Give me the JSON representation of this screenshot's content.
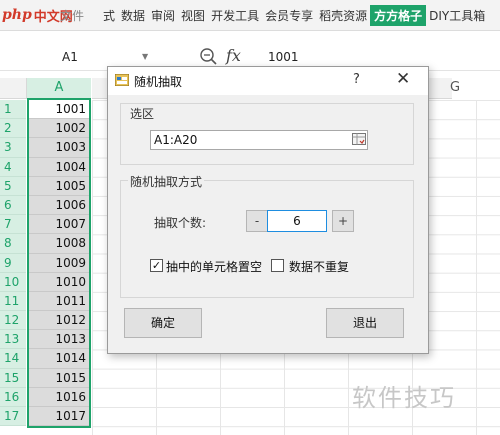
{
  "brand": {
    "logo_php": "php",
    "logo_cn": "中文网"
  },
  "ribbon": {
    "file_label": "文件",
    "tabs": [
      "式",
      "数据",
      "审阅",
      "视图",
      "开发工具",
      "会员专享",
      "稻壳资源",
      "方方格子",
      "DIY工具箱"
    ],
    "active_tab": "方方格子",
    "accent": "#1ea36a"
  },
  "formula_bar": {
    "name_box": "A1",
    "fx_label": "fx",
    "value": "1001"
  },
  "sheet": {
    "col_a": "A",
    "col_g": "G",
    "row_numbers": [
      "1",
      "2",
      "3",
      "4",
      "5",
      "6",
      "7",
      "8",
      "9",
      "10",
      "11",
      "12",
      "13",
      "14",
      "15",
      "16",
      "17"
    ],
    "col_a_values": [
      "1001",
      "1002",
      "1003",
      "1004",
      "1005",
      "1006",
      "1007",
      "1008",
      "1009",
      "1010",
      "1011",
      "1012",
      "1013",
      "1014",
      "1015",
      "1016",
      "1017"
    ]
  },
  "dialog": {
    "title": "随机抽取",
    "help": "?",
    "close": "✕",
    "range_group": "选区",
    "range_value": "A1:A20",
    "mode_group": "随机抽取方式",
    "count_label": "抽取个数:",
    "count_value": "6",
    "minus": "-",
    "plus": "+",
    "chk_empty_label": "抽中的单元格置空",
    "chk_empty_checked": true,
    "chk_norepeat_label": "数据不重复",
    "chk_norepeat_checked": false,
    "ok_label": "确定",
    "exit_label": "退出"
  },
  "watermark": "软件技巧"
}
